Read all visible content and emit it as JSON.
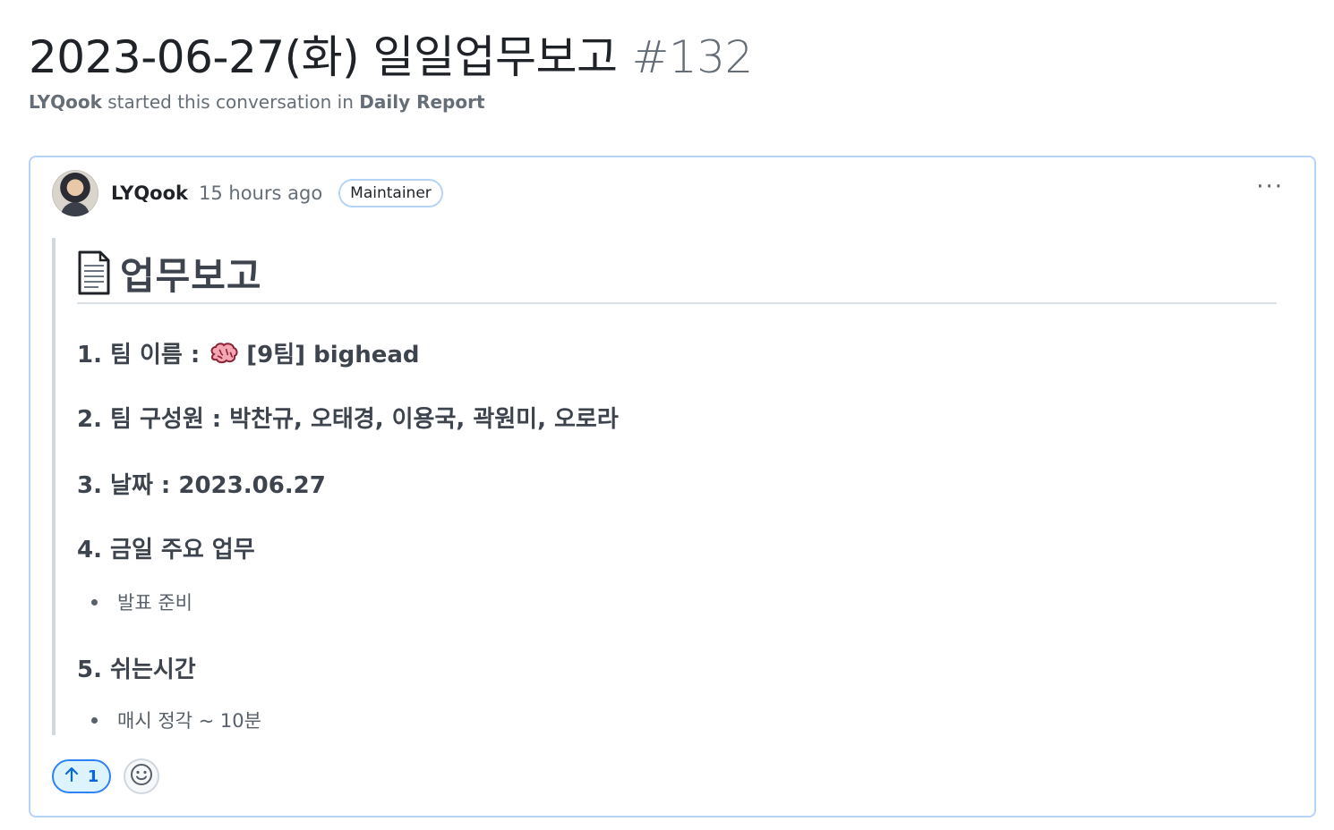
{
  "discussion": {
    "title": "2023-06-27(화) 일일업무보고",
    "number": "#132",
    "starter": "LYQook",
    "started_text": "started this conversation in",
    "category": "Daily Report"
  },
  "post": {
    "author": "LYQook",
    "time_ago": "15 hours ago",
    "role_badge": "Maintainer",
    "more_label": "···",
    "heading": "업무보고",
    "items": [
      {
        "label": "1. 팀 이름 :",
        "value": "[9팀] bighead"
      },
      {
        "label": "2. 팀 구성원 : 박찬규, 오태경, 이용국, 곽원미, 오로라"
      },
      {
        "label": "3. 날짜 : 2023.06.27"
      },
      {
        "label": "4. 금일 주요 업무"
      },
      {
        "label": "5. 쉬는시간"
      }
    ],
    "bullets": [
      "발표 준비",
      "매시 정각 ~ 10분"
    ]
  },
  "reactions": {
    "upvote_icon": "arrow-up-icon",
    "upvote_count": "1",
    "emoji_icon": "smiley-icon"
  },
  "colors": {
    "card_border": "#b6d4f7",
    "upvote_border": "#2f81f7",
    "upvote_bg": "#ddf4ff",
    "text_muted": "#656d76"
  }
}
